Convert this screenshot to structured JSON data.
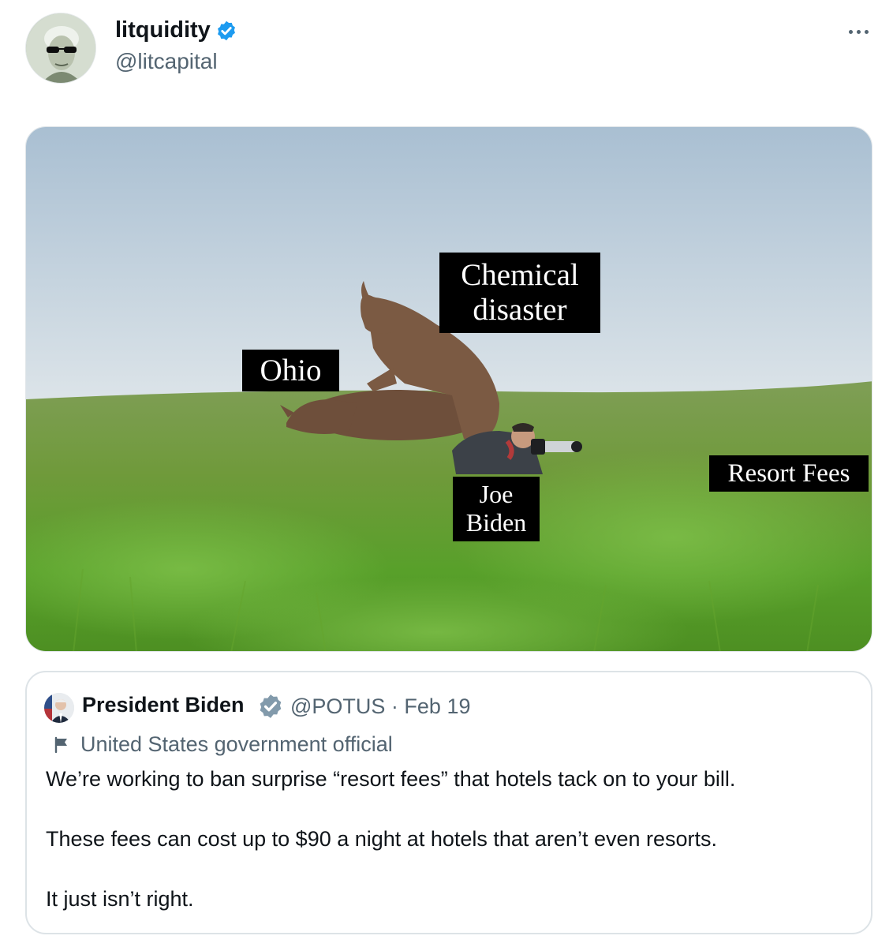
{
  "author": {
    "display_name": "litquidity",
    "handle": "@litcapital",
    "verified_icon": "verified-badge-icon",
    "more_icon": "more-horizontal-icon"
  },
  "media": {
    "captions": [
      {
        "id": "ohio",
        "text": "Ohio"
      },
      {
        "id": "chemical",
        "text": "Chemical\ndisaster"
      },
      {
        "id": "biden",
        "text": "Joe\nBiden"
      },
      {
        "id": "resort",
        "text": "Resort Fees"
      }
    ]
  },
  "quoted_tweet": {
    "display_name": "President Biden",
    "handle_date": "@POTUS · Feb 19",
    "label": "United States government official",
    "label_icon": "flag-icon",
    "verified_color": "#829aab",
    "lines": [
      "We’re working to ban surprise “resort fees” that hotels tack on to your bill.",
      "These fees can cost up to $90 a night at hotels that aren’t even resorts.",
      "It just isn’t right."
    ]
  },
  "colors": {
    "accent_blue": "#1d9bf0",
    "text_primary": "#0f1419",
    "text_secondary": "#536471",
    "border": "#dde3e7"
  }
}
